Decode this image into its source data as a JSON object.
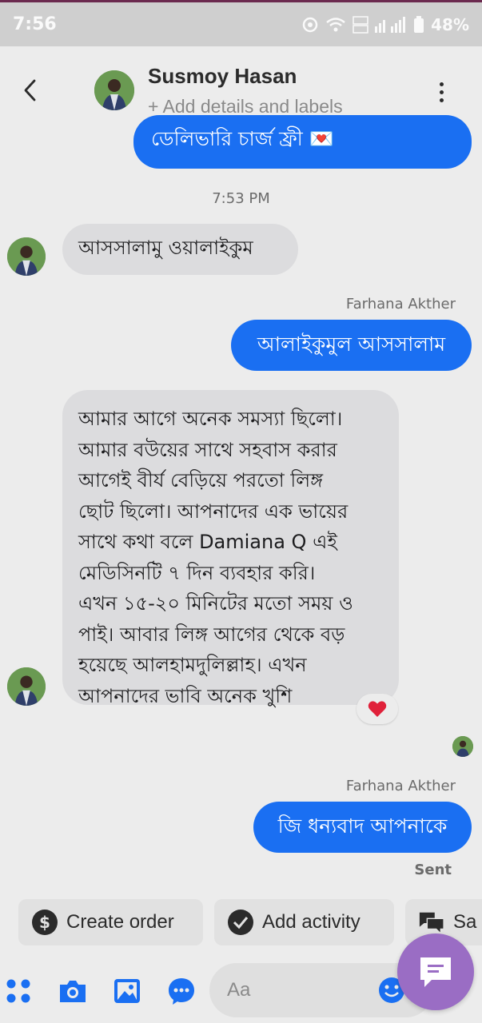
{
  "status_bar": {
    "time": "7:56",
    "battery": "48%"
  },
  "header": {
    "contact_name": "Susmoy Hasan",
    "subtitle": "+ Add details and labels"
  },
  "messages": {
    "clipped_outgoing": "ডেলিভারি চার্জ ফ্রী 💌",
    "timestamp": "7:53 PM",
    "incoming_1": "আসসালামু ওয়ালাইকুম",
    "sender_label_1": "Farhana Akther",
    "outgoing_1": "আলাইকুমুল আসসালাম",
    "incoming_2_lines": [
      "আমার আগে অনেক সমস্যা ছিলো।",
      "আমার বউয়ের সাথে সহবাস করার",
      "আগেই বীর্য বেড়িয়ে পরতো লিঙ্গ",
      "ছোট ছিলো। আপনাদের এক ভায়ের",
      "সাথে কথা বলে Damiana Q এই",
      "মেডিসিনটি ৭ দিন ব্যবহার করি।",
      "এখন ১৫-২০ মিনিটের মতো সময় ও",
      "পাই। আবার লিঙ্গ আগের  থেকে বড়",
      "হয়েছে আলহামদুলিল্লাহ। এখন",
      "আপনাদের ভাবি অনেক খুশি"
    ],
    "reaction": "❤️",
    "sender_label_2": "Farhana Akther",
    "outgoing_2": "জি ধন্যবাদ আপনাকে",
    "sent_status": "Sent"
  },
  "quick_actions": {
    "create_order": "Create order",
    "add_activity": "Add activity",
    "save": "Sa"
  },
  "composer": {
    "placeholder": "Aa"
  },
  "colors": {
    "outgoing_bubble": "#1a6ff2",
    "incoming_bubble": "#dcdcde",
    "fab": "#9a6dc4"
  }
}
